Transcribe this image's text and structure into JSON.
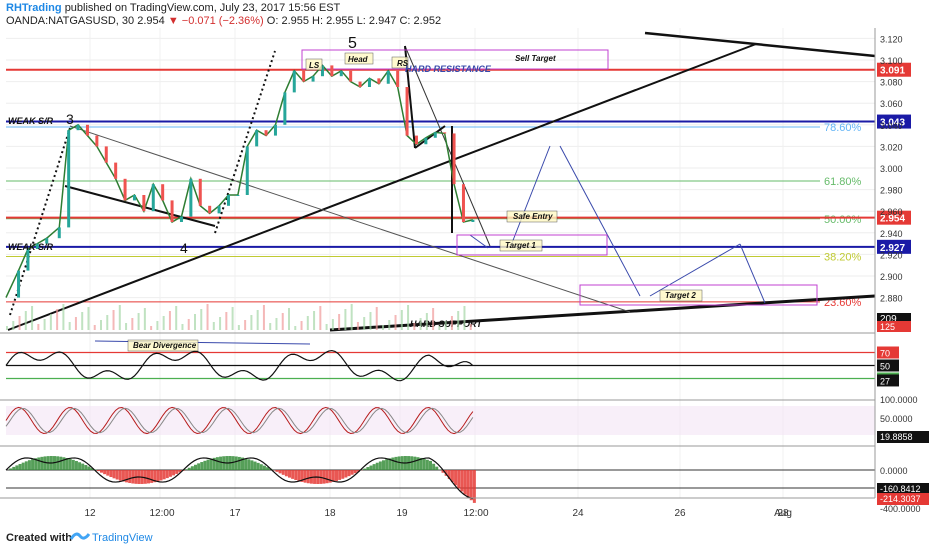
{
  "header": {
    "author": "RHTrading",
    "published": "published on TradingView.com, July 23, 2017 15:56 EST",
    "symbol": "OANDA:NATGASUSD, 30",
    "last": "2.954",
    "change": "▼ −0.071 (−2.36%)",
    "ohlc": "O: 2.955  H: 2.955  L: 2.947  C: 2.952"
  },
  "footer": {
    "created": "Created with",
    "brand": "TradingView"
  },
  "colors": {
    "up": "#26a69a",
    "down": "#ef5350",
    "red": "#e53935",
    "blue": "#1a1aa6",
    "green": "#4caf50",
    "purple": "#c040d0",
    "fib": "#90caf9"
  },
  "chart_data": {
    "type": "line",
    "instrument": "OANDA:NATGASUSD, 30",
    "ylim": [
      2.85,
      3.125
    ],
    "y_ticks": [
      "3.120",
      "3.100",
      "3.080",
      "3.060",
      "3.040",
      "3.020",
      "3.000",
      "2.980",
      "2.960",
      "2.940",
      "2.920",
      "2.900",
      "2.880"
    ],
    "x_ticks": [
      "12",
      "12:00",
      "17",
      "18",
      "19",
      "12:00",
      "24",
      "26",
      "28",
      "Aug"
    ],
    "price_path": [
      [
        0,
        2.88
      ],
      [
        4,
        2.905
      ],
      [
        7,
        2.925
      ],
      [
        10,
        2.93
      ],
      [
        13,
        2.935
      ],
      [
        17,
        2.945
      ],
      [
        20,
        3.035
      ],
      [
        23,
        3.04
      ],
      [
        26,
        3.03
      ],
      [
        29,
        3.02
      ],
      [
        32,
        3.005
      ],
      [
        35,
        2.99
      ],
      [
        38,
        2.97
      ],
      [
        41,
        2.975
      ],
      [
        44,
        2.96
      ],
      [
        47,
        2.985
      ],
      [
        50,
        2.97
      ],
      [
        53,
        2.95
      ],
      [
        56,
        2.955
      ],
      [
        59,
        2.99
      ],
      [
        62,
        2.965
      ],
      [
        65,
        2.958
      ],
      [
        68,
        2.965
      ],
      [
        71,
        2.975
      ],
      [
        74,
        2.975
      ],
      [
        77,
        3.02
      ],
      [
        80,
        3.035
      ],
      [
        83,
        3.03
      ],
      [
        86,
        3.04
      ],
      [
        89,
        3.07
      ],
      [
        92,
        3.09
      ],
      [
        95,
        3.08
      ],
      [
        98,
        3.085
      ],
      [
        101,
        3.095
      ],
      [
        104,
        3.085
      ],
      [
        107,
        3.09
      ],
      [
        110,
        3.08
      ],
      [
        113,
        3.075
      ],
      [
        116,
        3.083
      ],
      [
        119,
        3.078
      ],
      [
        122,
        3.09
      ],
      [
        125,
        3.075
      ],
      [
        128,
        3.03
      ],
      [
        131,
        3.022
      ],
      [
        134,
        3.028
      ],
      [
        137,
        3.033
      ],
      [
        140,
        3.032
      ],
      [
        143,
        2.985
      ],
      [
        146,
        2.95
      ],
      [
        149,
        2.952
      ]
    ],
    "horizontal_levels": [
      {
        "price": 3.091,
        "label": "3.091",
        "color": "#e53935"
      },
      {
        "price": 3.043,
        "label": "3.043",
        "color": "#1a1aa6"
      },
      {
        "price": 2.954,
        "label": "2.954",
        "color": "#e53935"
      },
      {
        "price": 2.927,
        "label": "2.927",
        "color": "#1a1aa6"
      }
    ],
    "fib_levels": [
      {
        "label": "78.60%",
        "price": 3.038,
        "color": "#64b5f6"
      },
      {
        "label": "61.80%",
        "price": 2.988,
        "color": "#66bb6a"
      },
      {
        "label": "50.00%",
        "price": 2.953,
        "color": "#66bb6a"
      },
      {
        "label": "38.20%",
        "price": 2.918,
        "color": "#c0ca33"
      },
      {
        "label": "23.60%",
        "price": 2.876,
        "color": "#e53935"
      }
    ],
    "annotations": [
      {
        "text": "5"
      },
      {
        "text": "3"
      },
      {
        "text": "4"
      },
      {
        "text": "LS"
      },
      {
        "text": "Head"
      },
      {
        "text": "RS"
      },
      {
        "text": "HARD RESISTANCE"
      },
      {
        "text": "Sell Target"
      },
      {
        "text": "WEAK S/R"
      },
      {
        "text": "WEAK S/R"
      },
      {
        "text": "Safe Entry"
      },
      {
        "text": "Target 1"
      },
      {
        "text": "Target 2"
      },
      {
        "text": "HARD SUPPORT"
      },
      {
        "text": "Bear Divergence"
      }
    ],
    "rsi_panel": {
      "levels": [
        70,
        50,
        30
      ],
      "value": 27,
      "labels": [
        "70",
        "50",
        "30",
        "27"
      ]
    },
    "stoch_panel": {
      "labels": [
        "100.0000",
        "50.0000",
        "19.8858"
      ]
    },
    "macd_panel": {
      "labels": [
        "0.0000",
        "-160.8412",
        "-214.3037",
        "-400.0000"
      ]
    },
    "volume_label": "209",
    "volume_label2": "125"
  }
}
